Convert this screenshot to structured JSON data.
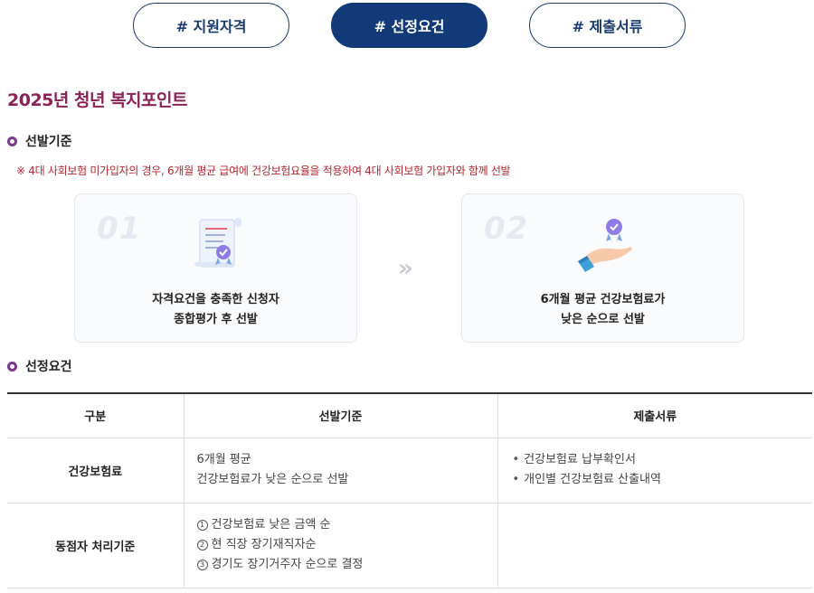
{
  "tabs": [
    {
      "label": "# 지원자격",
      "active": false
    },
    {
      "label": "# 선정요건",
      "active": true
    },
    {
      "label": "# 제출서류",
      "active": false
    }
  ],
  "page_title": "2025년 청년 복지포인트",
  "section1": {
    "title": "선발기준",
    "notice": "※ 4대 사회보험 미가입자의 경우, 6개월 평균 급여에 건강보험요율을 적용하여 4대 사회보험 가입자와 함께 선발"
  },
  "cards": [
    {
      "num": "01",
      "line1": "자격요건을 충족한 신청자",
      "line2": "종합평가 후 선발",
      "icon": "certificate-icon"
    },
    {
      "num": "02",
      "line1": "6개월 평균 건강보험료가",
      "line2": "낮은 순으로 선발",
      "icon": "hand-badge-icon"
    }
  ],
  "arrow": "»",
  "section2": {
    "title": "선정요건"
  },
  "table": {
    "headers": [
      "구분",
      "선발기준",
      "제출서류"
    ],
    "row1": {
      "label": "건강보험료",
      "criteria": [
        "6개월 평균",
        "건강보험료가 낮은 순으로 선발"
      ],
      "docs": [
        "건강보험료 납부확인서",
        "개인별 건강보험료 산출내역"
      ]
    },
    "row2": {
      "label": "동점자 처리기준",
      "criteria_marks": [
        "1",
        "2",
        "3"
      ],
      "criteria": [
        "건강보험료 낮은 금액 순",
        "현 직장 장기재직자순",
        "경기도 장기거주자 순으로 결정"
      ]
    }
  },
  "colors": {
    "accent_navy": "#123a78",
    "title_magenta": "#8b2256",
    "notice_red": "#b3262e",
    "dot_purple": "#7a3a8c"
  }
}
